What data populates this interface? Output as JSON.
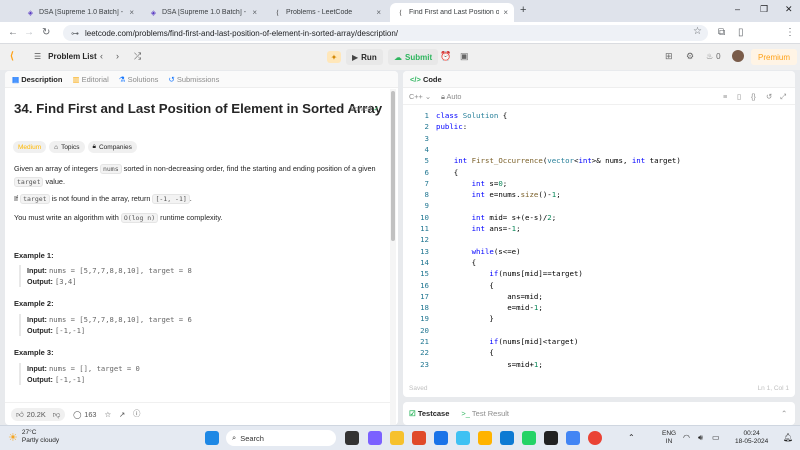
{
  "browser": {
    "tabs": [
      {
        "title": "DSA [Supreme 1.0 Batch] - Cou",
        "icon": "codehelp-icon",
        "active": false
      },
      {
        "title": "DSA [Supreme 1.0 Batch] - Cou",
        "icon": "codehelp-icon",
        "active": false
      },
      {
        "title": "Problems - LeetCode",
        "icon": "leetcode-icon",
        "active": false
      },
      {
        "title": "Find First and Last Position of E",
        "icon": "leetcode-icon",
        "active": true
      }
    ],
    "url": "leetcode.com/problems/find-first-and-last-position-of-element-in-sorted-array/description/",
    "profile_initial": "A"
  },
  "lc_nav": {
    "problem_list": "Problem List",
    "run": "Run",
    "submit": "Submit",
    "streak": "0",
    "premium": "Premium"
  },
  "left": {
    "tabs": [
      "Description",
      "Editorial",
      "Solutions",
      "Submissions"
    ],
    "title": "34. Find First and Last Position of Element in Sorted Array",
    "solved": "Solved",
    "difficulty": "Medium",
    "tags": [
      "Topics",
      "Companies"
    ],
    "desc": {
      "p1_a": "Given an array of integers ",
      "p1_code1": "nums",
      "p1_b": " sorted in non-decreasing order, find the starting and ending position of a given",
      "p1_code2": "target",
      "p1_c": " value.",
      "p2_a": "If ",
      "p2_code1": "target",
      "p2_b": " is not found in the array, return ",
      "p2_code2": "[-1, -1]",
      "p2_c": ".",
      "p3_a": "You must write an algorithm with ",
      "p3_code": "O(log n)",
      "p3_b": " runtime complexity."
    },
    "examples": [
      {
        "title": "Example 1:",
        "input_label": "Input:",
        "input": "nums = [5,7,7,8,8,10], target = 8",
        "output_label": "Output:",
        "output": "[3,4]"
      },
      {
        "title": "Example 2:",
        "input_label": "Input:",
        "input": "nums = [5,7,7,8,8,10], target = 6",
        "output_label": "Output:",
        "output": "[-1,-1]"
      },
      {
        "title": "Example 3:",
        "input_label": "Input:",
        "input": "nums = [], target = 0",
        "output_label": "Output:",
        "output": "[-1,-1]"
      }
    ],
    "likes": "20.2K",
    "comments": "163"
  },
  "editor": {
    "title": "Code",
    "language": "C++",
    "mode": "Auto",
    "status_left": "Saved",
    "status_right": "Ln 1, Col 1",
    "lines": [
      "class Solution {",
      "public:",
      "",
      "",
      "    int First_Occurrence(vector<int>& nums, int target)",
      "    {",
      "        int s=0;",
      "        int e=nums.size()-1;",
      "",
      "        int mid= s+(e-s)/2;",
      "        int ans=-1;",
      "",
      "        while(s<=e)",
      "        {",
      "            if(nums[mid]==target)",
      "            {",
      "                ans=mid;",
      "                e=mid-1;",
      "            }",
      "",
      "            if(nums[mid]<target)",
      "            {",
      "                s=mid+1;"
    ]
  },
  "bottom": {
    "testcase": "Testcase",
    "test_result": "Test Result"
  },
  "taskbar": {
    "weather_temp": "27°C",
    "weather_desc": "Partly cloudy",
    "search": "Search",
    "lang": "ENG",
    "region": "IN",
    "time": "00:24",
    "date": "18-05-2024"
  }
}
